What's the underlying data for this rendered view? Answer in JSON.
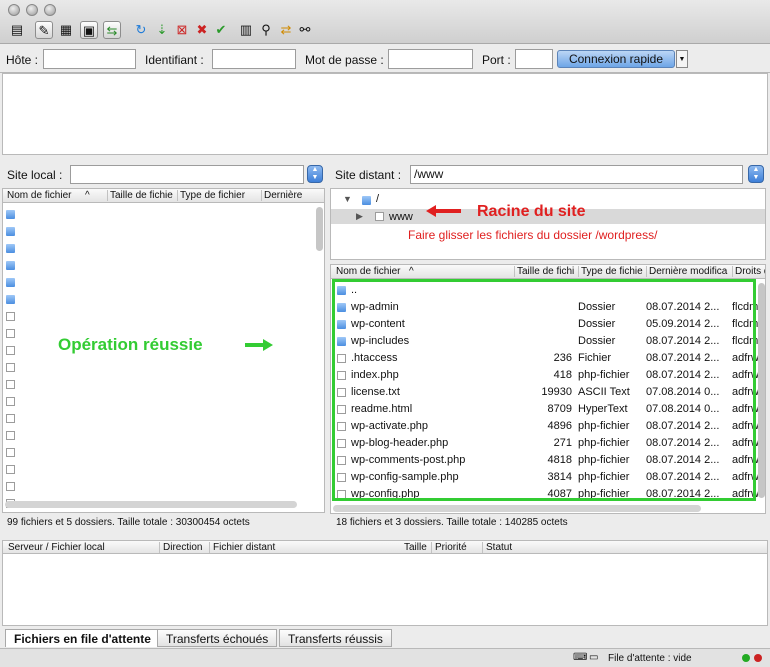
{
  "toolbar": {
    "icons": [
      "site-manager-icon",
      "toggle-log-icon",
      "toggle-local-tree-icon",
      "toggle-remote-tree-icon",
      "toggle-queue-icon",
      "refresh-icon",
      "process-queue-icon",
      "cancel-icon",
      "disconnect-icon",
      "reconnect-icon",
      "directory-comparison-icon",
      "filter-icon",
      "sync-browse-icon",
      "search-icon"
    ]
  },
  "quickconnect": {
    "host_label": "Hôte :",
    "user_label": "Identifiant :",
    "pass_label": "Mot de passe :",
    "port_label": "Port :",
    "host_value": "",
    "user_value": "",
    "pass_value": "",
    "port_value": "",
    "button_label": "Connexion rapide"
  },
  "local": {
    "site_label": "Site local :",
    "path": "",
    "columns": [
      "Nom de fichier",
      "Taille de fichie",
      "Type de fichier",
      "Dernière"
    ],
    "status": "99 fichiers et 5 dossiers. Taille totale : 30300454 octets"
  },
  "remote": {
    "site_label": "Site distant :",
    "path": "/www",
    "tree": [
      {
        "name": "/"
      },
      {
        "name": "www"
      }
    ],
    "columns": [
      "Nom de fichier",
      "Taille de fichi",
      "Type de fichie",
      "Dernière modifica",
      "Droits d"
    ],
    "files": [
      {
        "name": "..",
        "size": "",
        "type": "",
        "date": "",
        "perms": "",
        "kind": "folder"
      },
      {
        "name": "wp-admin",
        "size": "",
        "type": "Dossier",
        "date": "08.07.2014 2...",
        "perms": "flcdm",
        "kind": "folder"
      },
      {
        "name": "wp-content",
        "size": "",
        "type": "Dossier",
        "date": "05.09.2014 2...",
        "perms": "flcdm",
        "kind": "folder"
      },
      {
        "name": "wp-includes",
        "size": "",
        "type": "Dossier",
        "date": "08.07.2014 2...",
        "perms": "flcdm",
        "kind": "folder"
      },
      {
        "name": ".htaccess",
        "size": "236",
        "type": "Fichier",
        "date": "08.07.2014 2...",
        "perms": "adfrw",
        "kind": "file"
      },
      {
        "name": "index.php",
        "size": "418",
        "type": "php-fichier",
        "date": "08.07.2014 2...",
        "perms": "adfrw",
        "kind": "file"
      },
      {
        "name": "license.txt",
        "size": "19930",
        "type": "ASCII Text",
        "date": "07.08.2014 0...",
        "perms": "adfrw",
        "kind": "file"
      },
      {
        "name": "readme.html",
        "size": "8709",
        "type": "HyperText",
        "date": "07.08.2014 0...",
        "perms": "adfrw",
        "kind": "file"
      },
      {
        "name": "wp-activate.php",
        "size": "4896",
        "type": "php-fichier",
        "date": "08.07.2014 2...",
        "perms": "adfrw",
        "kind": "file"
      },
      {
        "name": "wp-blog-header.php",
        "size": "271",
        "type": "php-fichier",
        "date": "08.07.2014 2...",
        "perms": "adfrw",
        "kind": "file"
      },
      {
        "name": "wp-comments-post.php",
        "size": "4818",
        "type": "php-fichier",
        "date": "08.07.2014 2...",
        "perms": "adfrw",
        "kind": "file"
      },
      {
        "name": "wp-config-sample.php",
        "size": "3814",
        "type": "php-fichier",
        "date": "08.07.2014 2...",
        "perms": "adfrw",
        "kind": "file"
      },
      {
        "name": "wp-config.php",
        "size": "4087",
        "type": "php-fichier",
        "date": "08.07.2014 2...",
        "perms": "adfrw",
        "kind": "file"
      }
    ],
    "status": "18 fichiers et 3 dossiers. Taille totale : 140285 octets"
  },
  "annotations": {
    "root": "Racine du site",
    "drag": "Faire glisser les fichiers du dossier /wordpress/",
    "success": "Opération réussie",
    "red": "#e02020",
    "green": "#33cc33"
  },
  "queue": {
    "columns": [
      "Serveur / Fichier local",
      "Direction",
      "Fichier distant",
      "Taille",
      "Priorité",
      "Statut"
    ],
    "tabs": [
      "Fichiers en file d'attente",
      "Transferts échoués",
      "Transferts réussis"
    ],
    "status": "File d'attente : vide"
  }
}
